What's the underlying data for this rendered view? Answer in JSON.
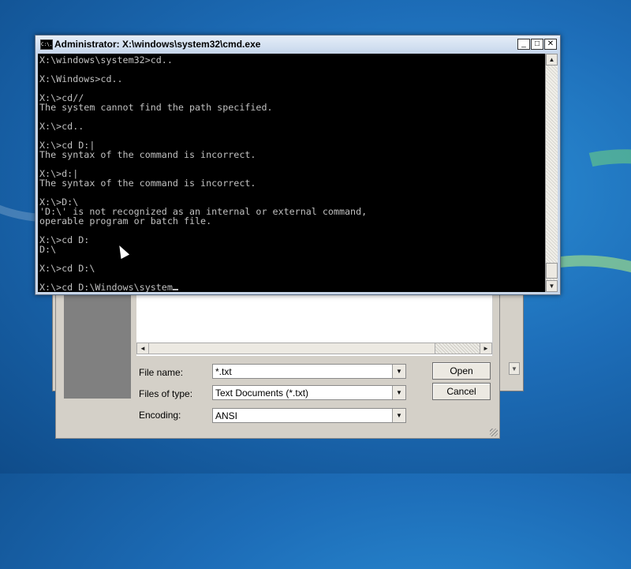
{
  "cmd_window": {
    "title": "Administrator: X:\\windows\\system32\\cmd.exe",
    "icon_label": "C:\\.",
    "controls": {
      "minimize": "_",
      "maximize": "□",
      "close": "✕"
    },
    "output": "X:\\windows\\system32>cd..\n\nX:\\Windows>cd..\n\nX:\\>cd//\nThe system cannot find the path specified.\n\nX:\\>cd..\n\nX:\\>cd D:|\nThe syntax of the command is incorrect.\n\nX:\\>d:|\nThe syntax of the command is incorrect.\n\nX:\\>D:\\\n'D:\\' is not recognized as an internal or external command,\noperable program or batch file.\n\nX:\\>cd D:\nD:\\\n\nX:\\>cd D:\\\n\n",
    "current_input": "X:\\>cd D:\\Windows\\system"
  },
  "file_dialog": {
    "file_name_label": "File name:",
    "file_name_value": "*.txt",
    "files_of_type_label": "Files of type:",
    "files_of_type_value": "Text Documents (*.txt)",
    "encoding_label": "Encoding:",
    "encoding_value": "ANSI",
    "open_button": "Open",
    "cancel_button": "Cancel"
  },
  "glyphs": {
    "up": "▲",
    "down": "▼",
    "left": "◄",
    "right": "►"
  }
}
